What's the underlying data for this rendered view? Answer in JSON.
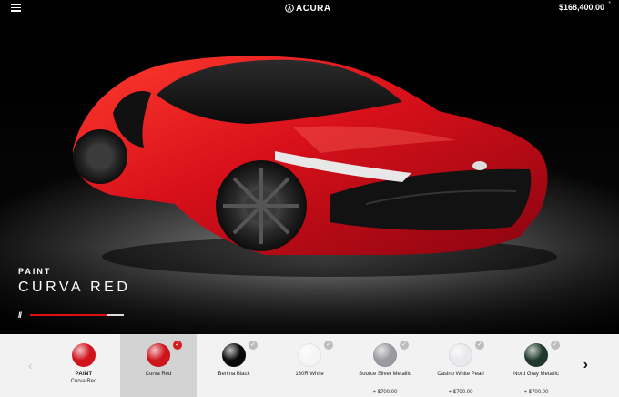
{
  "header": {
    "brand": "ACURA",
    "price": "$168,400.00",
    "price_marker": "*"
  },
  "hero": {
    "section_label": "PAINT",
    "color_name": "CURVA RED",
    "slash_glyph": "//",
    "progress_fraction": 0.83
  },
  "swatch_bar": {
    "prev_glyph": "‹",
    "next_glyph": "›",
    "summary": {
      "title": "PAINT",
      "value": "Curva Red"
    },
    "swatches": [
      {
        "name": "Curva Red",
        "price": "",
        "selected": true,
        "color": "#d0141c"
      },
      {
        "name": "Berlina Black",
        "price": "",
        "selected": false,
        "color": "#0a0a0a"
      },
      {
        "name": "130R White",
        "price": "",
        "selected": false,
        "color": "#f5f5f5"
      },
      {
        "name": "Source Silver Metallic",
        "price": "+ $700.00",
        "selected": false,
        "color": "#9a9ba0"
      },
      {
        "name": "Casino White Pearl",
        "price": "+ $700.00",
        "selected": false,
        "color": "#e8e9ec"
      },
      {
        "name": "Nord Gray Metallic",
        "price": "+ $700.00",
        "selected": false,
        "color": "#1f3a2d"
      }
    ]
  },
  "colors": {
    "accent": "#d21d1d",
    "bar_bg": "#f2f2f2",
    "selected_bg": "#d3d3d3"
  }
}
